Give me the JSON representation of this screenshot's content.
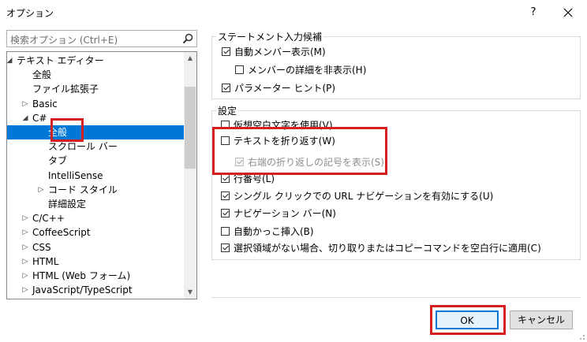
{
  "window": {
    "title": "オプション",
    "help": "?"
  },
  "search": {
    "placeholder": "検索オプション (Ctrl+E)"
  },
  "tree": {
    "items": [
      {
        "label": "テキスト エディター",
        "expander": "◢"
      },
      {
        "label": "全般",
        "expander": ""
      },
      {
        "label": "ファイル拡張子",
        "expander": ""
      },
      {
        "label": "Basic",
        "expander": "▷"
      },
      {
        "label": "C#",
        "expander": "◢"
      },
      {
        "label": "全般",
        "expander": ""
      },
      {
        "label": "スクロール バー",
        "expander": ""
      },
      {
        "label": "タブ",
        "expander": ""
      },
      {
        "label": "IntelliSense",
        "expander": ""
      },
      {
        "label": "コード スタイル",
        "expander": "▷"
      },
      {
        "label": "詳細設定",
        "expander": ""
      },
      {
        "label": "C/C++",
        "expander": "▷"
      },
      {
        "label": "CoffeeScript",
        "expander": "▷"
      },
      {
        "label": "CSS",
        "expander": "▷"
      },
      {
        "label": "HTML",
        "expander": "▷"
      },
      {
        "label": "HTML (Web フォーム)",
        "expander": "▷"
      },
      {
        "label": "JavaScript/TypeScript",
        "expander": "▷"
      }
    ],
    "selected_index": 5
  },
  "statement_group": {
    "title": "ステートメント入力候補",
    "options": [
      {
        "label": "自動メンバー表示(M)",
        "checked": true,
        "enabled": true
      },
      {
        "label": "メンバーの詳細を非表示(H)",
        "checked": false,
        "enabled": true
      },
      {
        "label": "パラメーター ヒント(P)",
        "checked": true,
        "enabled": true
      }
    ]
  },
  "settings_group": {
    "title": "設定",
    "options": [
      {
        "label": "仮想空白文字を使用(V)",
        "checked": false,
        "enabled": true
      },
      {
        "label": "テキストを折り返す(W)",
        "checked": false,
        "enabled": true
      },
      {
        "label": "右端の折り返しの記号を表示(S)",
        "checked": true,
        "enabled": false
      },
      {
        "label": "行番号(L)",
        "checked": true,
        "enabled": true
      },
      {
        "label": "シングル クリックでの URL ナビゲーションを有効にする(U)",
        "checked": true,
        "enabled": true
      },
      {
        "label": "ナビゲーション バー(N)",
        "checked": true,
        "enabled": true
      },
      {
        "label": "自動かっこ挿入(B)",
        "checked": false,
        "enabled": true
      },
      {
        "label": "選択領域がない場合、切り取りまたはコピーコマンドを空白行に適用(C)",
        "checked": true,
        "enabled": true
      }
    ]
  },
  "buttons": {
    "ok": "OK",
    "cancel": "キャンセル"
  },
  "colors": {
    "selection": "#0078d7",
    "highlight": "#d42020"
  }
}
